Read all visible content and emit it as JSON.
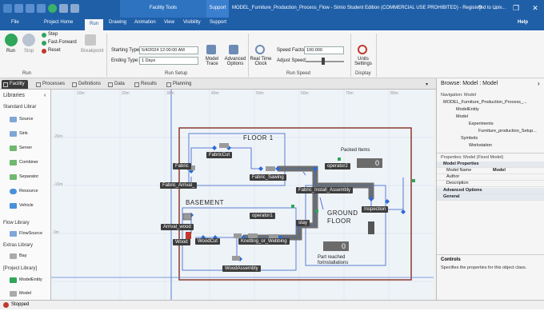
{
  "titlebar": {
    "context_tab": "Facility Tools",
    "support": "Support",
    "window_title": "MODEL_Furniture_Production_Process_Flow - Simio Student Edition (COMMERCIAL USE PROHIBITED) - Registered to Univ...",
    "colors": {
      "bar": "#1f5fa8"
    }
  },
  "tabs": {
    "file": "File",
    "project_home": "Project Home",
    "run": "Run",
    "drawing": "Drawing",
    "animation": "Animation",
    "view": "View",
    "visibility": "Visibility",
    "support": "Support",
    "help": "Help"
  },
  "ribbon": {
    "run_label": "Run",
    "stop_label": "Stop",
    "step_label": "Step",
    "fast_forward_label": "Fast-Forward",
    "reset_label": "Reset",
    "breakpoint_label": "Breakpoint",
    "starting_type_label": "Starting Type:",
    "starting_type_value": "5/4/2024 12:00:00 AM",
    "ending_type_label": "Ending Type:",
    "ending_type_value": "1 Days",
    "model_trace_label": "Model Trace",
    "advanced_options_label": "Advanced Options",
    "real_time_clock_label": "Real Time Clock",
    "speed_factor_label": "Speed Factor:",
    "speed_factor_value": "100.000",
    "adjust_speed_label": "Adjust Speed:",
    "units_settings_label": "Units Settings",
    "group_run": "Run",
    "group_run_setup": "Run Setup",
    "group_run_speed": "Run Speed",
    "group_display": "Display"
  },
  "doctabs": [
    "Facility",
    "Processes",
    "Definitions",
    "Data",
    "Results",
    "Planning"
  ],
  "libraries": {
    "title": "Libraries",
    "standard_header": "Standard Librar",
    "standard_items": [
      "Source",
      "Sink",
      "Server",
      "Combiner",
      "Separator",
      "Resource",
      "Vehicle"
    ],
    "flow_header": "Flow Library",
    "flow_item": "FlowSource",
    "extras_header": "Extras Library",
    "extras_item": "Bay",
    "project_header": "[Project Library]",
    "project_items": [
      "ModelEntity",
      "Model"
    ]
  },
  "canvas": {
    "ruler": [
      "10m",
      "20m",
      "30m",
      "40m",
      "50m",
      "60m",
      "70m",
      "80m"
    ],
    "ruler_left": [
      "-20m",
      "-10m",
      "0m"
    ],
    "floor1": "FLOOR 1",
    "basement": "BASEMENT",
    "ground_floor": "GROUND FLOOR",
    "packed_items": "Packed Items",
    "packed_count": "0",
    "part_reached": "Part reached forinstallations",
    "part_count": "0",
    "nodes": [
      "Fabric",
      "FabricCut",
      "Fabric_Arrival_",
      "Fabric_Sawing",
      "operator2",
      "Fabric_Install_Assembly",
      "Inspection",
      "operator1",
      "stay",
      "Arrival_wood",
      "Wood",
      "WoodCut",
      "Knetting_or_Webbing",
      "WoodAssembly"
    ]
  },
  "right": {
    "browse_title": "Browse: Model : Model",
    "nav_label": "Navigation: Model",
    "tree": [
      "MODEL_Furniture_Production_Process_...",
      "ModelEntity",
      "Model",
      "Experiments",
      "Furniture_production_Setup...",
      "Symbols",
      "Workstation"
    ],
    "props_title": "Properties: Model (Fixed Model)",
    "model_properties": "Model Properties",
    "model_name_label": "Model Name",
    "model_name_value": "Model",
    "author_label": "Author",
    "description_label": "Description",
    "advanced_options": "Advanced Options",
    "general": "General",
    "controls_title": "Controls",
    "controls_desc": "Specifies the properties for this object class."
  },
  "status": {
    "text": "Stopped"
  }
}
